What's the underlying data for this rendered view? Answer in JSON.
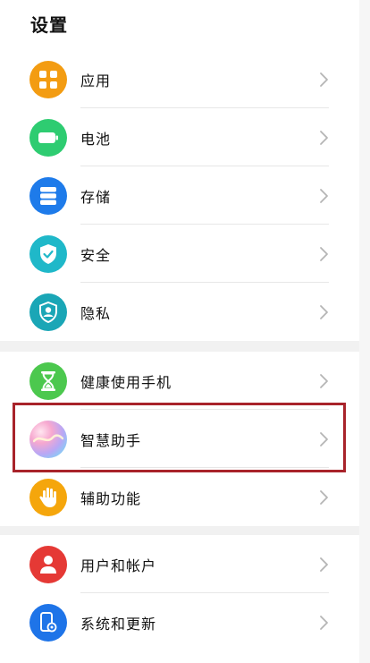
{
  "header": {
    "title": "设置"
  },
  "group1": {
    "items": [
      {
        "label": "应用",
        "icon": "apps-icon",
        "color": "#F39C12"
      },
      {
        "label": "电池",
        "icon": "battery-icon",
        "color": "#2ECC71"
      },
      {
        "label": "存储",
        "icon": "storage-icon",
        "color": "#1E7BEA"
      },
      {
        "label": "安全",
        "icon": "shield-check-icon",
        "color": "#1FB8C9"
      },
      {
        "label": "隐私",
        "icon": "privacy-icon",
        "color": "#1AA6B6"
      }
    ]
  },
  "group2": {
    "items": [
      {
        "label": "健康使用手机",
        "icon": "hourglass-icon",
        "color": "#4CC84E"
      },
      {
        "label": "智慧助手",
        "icon": "assistant-gradient-icon",
        "color": "#B9A7F5"
      },
      {
        "label": "辅助功能",
        "icon": "hand-icon",
        "color": "#F5A60C"
      }
    ]
  },
  "group3": {
    "items": [
      {
        "label": "用户和帐户",
        "icon": "user-icon",
        "color": "#E53935"
      },
      {
        "label": "系统和更新",
        "icon": "system-update-icon",
        "color": "#1E74E8"
      }
    ]
  }
}
